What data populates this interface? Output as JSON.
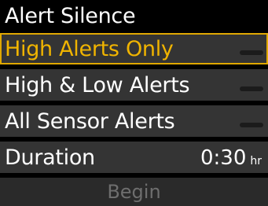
{
  "title": "Alert Silence",
  "options": [
    {
      "label": "High Alerts Only",
      "selected": true,
      "enabled": false
    },
    {
      "label": "High & Low Alerts",
      "selected": false,
      "enabled": false
    },
    {
      "label": "All Sensor Alerts",
      "selected": false,
      "enabled": false
    }
  ],
  "duration": {
    "label": "Duration",
    "value": "0:30",
    "unit": "hr"
  },
  "begin_label": "Begin",
  "colors": {
    "highlight": "#f0b400",
    "row_bg": "#343434",
    "disabled_text": "#6e6e6e"
  }
}
